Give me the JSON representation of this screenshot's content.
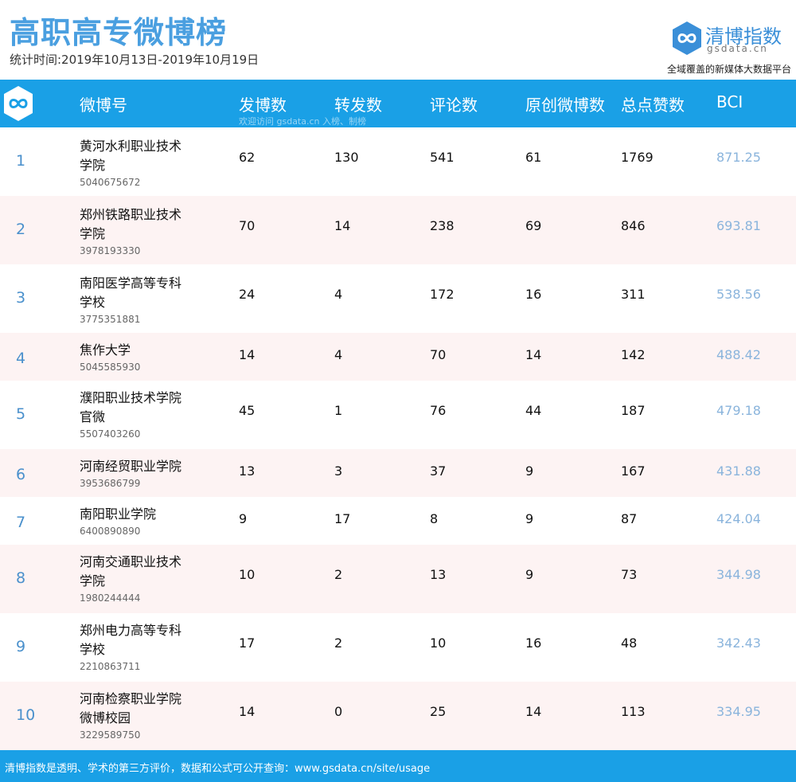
{
  "page": {
    "title": "高职高专微博榜",
    "period": "统计时间:2019年10月13日-2019年10月19日"
  },
  "brand": {
    "name_part1": "清博",
    "name_part2": "指数",
    "domain": "gsdata.cn",
    "slogan": "全域覆盖的新媒体大数据平台",
    "icon": "infinity-hexagon-logo"
  },
  "table": {
    "headers": {
      "account": "微博号",
      "posts": "发博数",
      "reposts": "转发数",
      "comments": "评论数",
      "original": "原创微博数",
      "likes": "总点赞数",
      "bci": "BCI"
    },
    "header_note": "欢迎访问 gsdata.cn 入榜、制榜",
    "rows": [
      {
        "rank": "1",
        "name_l1": "黄河水利职业技术",
        "name_l2": "学院",
        "id": "5040675672",
        "posts": "62",
        "reposts": "130",
        "comments": "541",
        "original": "61",
        "likes": "1769",
        "bci": "871.25"
      },
      {
        "rank": "2",
        "name_l1": "郑州铁路职业技术",
        "name_l2": "学院",
        "id": "3978193330",
        "posts": "70",
        "reposts": "14",
        "comments": "238",
        "original": "69",
        "likes": "846",
        "bci": "693.81"
      },
      {
        "rank": "3",
        "name_l1": "南阳医学高等专科",
        "name_l2": "学校",
        "id": "3775351881",
        "posts": "24",
        "reposts": "4",
        "comments": "172",
        "original": "16",
        "likes": "311",
        "bci": "538.56"
      },
      {
        "rank": "4",
        "name_l1": "焦作大学",
        "name_l2": "",
        "id": "5045585930",
        "posts": "14",
        "reposts": "4",
        "comments": "70",
        "original": "14",
        "likes": "142",
        "bci": "488.42"
      },
      {
        "rank": "5",
        "name_l1": "濮阳职业技术学院",
        "name_l2": "官微",
        "id": "5507403260",
        "posts": "45",
        "reposts": "1",
        "comments": "76",
        "original": "44",
        "likes": "187",
        "bci": "479.18"
      },
      {
        "rank": "6",
        "name_l1": "河南经贸职业学院",
        "name_l2": "",
        "id": "3953686799",
        "posts": "13",
        "reposts": "3",
        "comments": "37",
        "original": "9",
        "likes": "167",
        "bci": "431.88"
      },
      {
        "rank": "7",
        "name_l1": "南阳职业学院",
        "name_l2": "",
        "id": "6400890890",
        "posts": "9",
        "reposts": "17",
        "comments": "8",
        "original": "9",
        "likes": "87",
        "bci": "424.04"
      },
      {
        "rank": "8",
        "name_l1": "河南交通职业技术",
        "name_l2": "学院",
        "id": "1980244444",
        "posts": "10",
        "reposts": "2",
        "comments": "13",
        "original": "9",
        "likes": "73",
        "bci": "344.98"
      },
      {
        "rank": "9",
        "name_l1": "郑州电力高等专科",
        "name_l2": "学校",
        "id": "2210863711",
        "posts": "17",
        "reposts": "2",
        "comments": "10",
        "original": "16",
        "likes": "48",
        "bci": "342.43"
      },
      {
        "rank": "10",
        "name_l1": "河南检察职业学院",
        "name_l2": "微博校园",
        "id": "3229589750",
        "posts": "14",
        "reposts": "0",
        "comments": "25",
        "original": "14",
        "likes": "113",
        "bci": "334.95"
      }
    ]
  },
  "footer": {
    "text": "清博指数是透明、学术的第三方评价，数据和公式可公开查询：www.gsdata.cn/site/usage"
  },
  "colors": {
    "accent_blue": "#1aa0e6",
    "title_blue": "#4a9fe0",
    "alt_row": "#fdf3f3",
    "bci_text": "#8ab4dc"
  }
}
